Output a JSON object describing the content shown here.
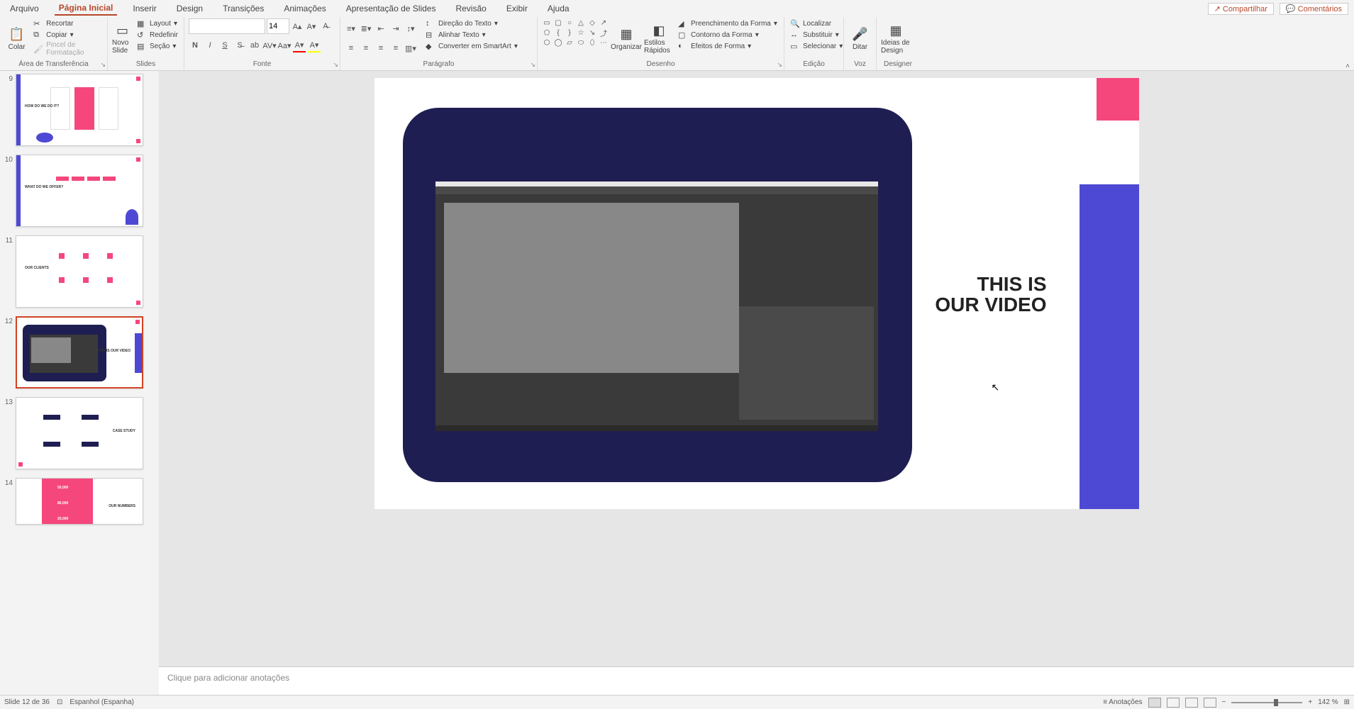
{
  "tabs": {
    "arquivo": "Arquivo",
    "inicio": "Página Inicial",
    "inserir": "Inserir",
    "design": "Design",
    "transicoes": "Transições",
    "animacoes": "Animações",
    "apresentacao": "Apresentação de Slides",
    "revisao": "Revisão",
    "exibir": "Exibir",
    "ajuda": "Ajuda"
  },
  "topright": {
    "share": "Compartilhar",
    "comments": "Comentários"
  },
  "groups": {
    "clipboard": "Área de Transferência",
    "slides": "Slides",
    "font": "Fonte",
    "paragraph": "Parágrafo",
    "drawing": "Desenho",
    "editing": "Edição",
    "voice": "Voz",
    "designer": "Designer"
  },
  "clipboard": {
    "paste": "Colar",
    "cut": "Recortar",
    "copy": "Copiar",
    "format": "Pincel de Formatação"
  },
  "slides": {
    "new": "Novo Slide",
    "layout": "Layout",
    "reset": "Redefinir",
    "section": "Seção"
  },
  "font": {
    "size": "14"
  },
  "paragraph": {
    "textdir": "Direção do Texto",
    "align": "Alinhar Texto",
    "smartart": "Converter em SmartArt"
  },
  "drawing": {
    "arrange": "Organizar",
    "styles": "Estilos Rápidos",
    "fill": "Preenchimento da Forma",
    "outline": "Contorno da Forma",
    "effects": "Efeitos de Forma"
  },
  "editing": {
    "find": "Localizar",
    "replace": "Substituir",
    "select": "Selecionar"
  },
  "voice": {
    "dictate": "Ditar"
  },
  "designer": {
    "ideas": "Ideias de Design"
  },
  "thumbs": [
    {
      "n": "9",
      "title": "HOW DO WE DO IT?"
    },
    {
      "n": "10",
      "title": "WHAT DO WE OFFER?"
    },
    {
      "n": "11",
      "title": "OUR CLIENTS"
    },
    {
      "n": "12",
      "title": "THIS IS OUR VIDEO"
    },
    {
      "n": "13",
      "title": "CASE STUDY"
    },
    {
      "n": "14",
      "title": "OUR NUMBERS",
      "v1": "50,000",
      "v2": "80,000",
      "v3": "20,000"
    }
  ],
  "slide": {
    "title_l1": "THIS IS",
    "title_l2": "OUR VIDEO"
  },
  "notes": {
    "placeholder": "Clique para adicionar anotações"
  },
  "status": {
    "slide": "Slide 12 de 36",
    "lang": "Espanhol (Espanha)",
    "notes": "Anotações",
    "zoom": "142 %"
  }
}
